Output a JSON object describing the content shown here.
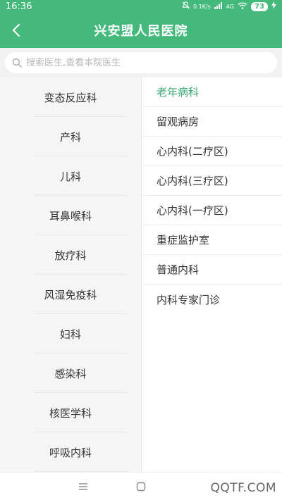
{
  "status_bar": {
    "time": "16:36",
    "network": "0.1K/s",
    "signal": "4G",
    "battery": "73"
  },
  "header": {
    "title": "兴安盟人民医院"
  },
  "search": {
    "placeholder": "搜索医生,查看本院医生"
  },
  "departments": [
    "变态反应科",
    "产科",
    "儿科",
    "耳鼻喉科",
    "放疗科",
    "风湿免疫科",
    "妇科",
    "感染科",
    "核医学科",
    "呼吸内科"
  ],
  "sub_departments": [
    "老年病科",
    "留观病房",
    "心内科(二疗区)",
    "心内科(三疗区)",
    "心内科(一疗区)",
    "重症监护室",
    "普通内科",
    "内科专家门诊"
  ],
  "watermark": "QQTF.COM",
  "colors": {
    "primary": "#45b97c",
    "active_text": "#3aa86f",
    "left_bg": "#f5f5f5"
  }
}
